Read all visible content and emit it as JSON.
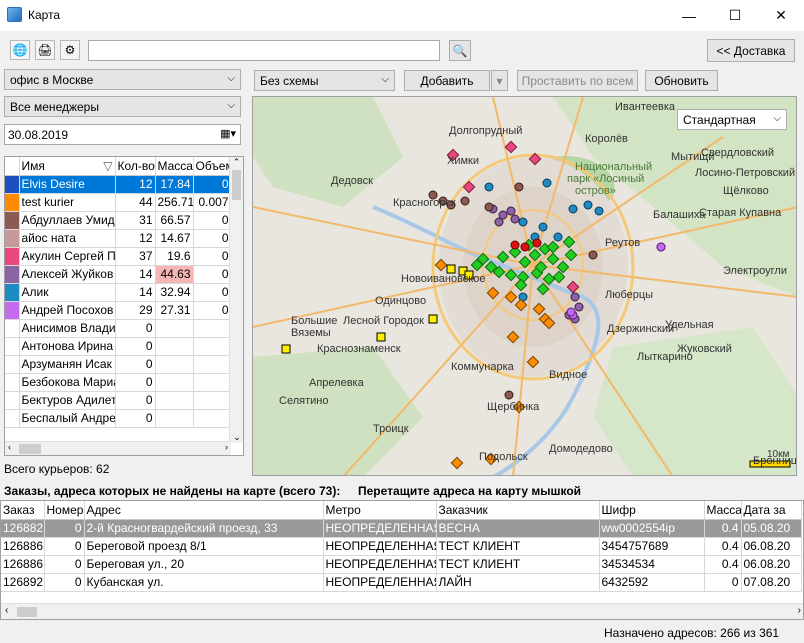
{
  "window": {
    "title": "Карта",
    "min": "—",
    "max": "☐",
    "close": "✕"
  },
  "toolbar": {
    "search_value": "",
    "delivery_button": "<< Доставка"
  },
  "filters": {
    "office": "офис в Москве",
    "managers": "Все менеджеры",
    "date": "30.08.2019"
  },
  "couriers": {
    "columns": [
      "Имя",
      "Кол-во",
      "Масса",
      "Объем"
    ],
    "rows": [
      {
        "color": "#1f4fbf",
        "name": "Elvis Desire",
        "qty": "12",
        "mass": "17.84",
        "vol": "0"
      },
      {
        "color": "#ff8c00",
        "name": "test kurier",
        "qty": "44",
        "mass": "256.71",
        "vol": "0.007"
      },
      {
        "color": "#8b5a52",
        "name": "Абдуллаев Умид Ш",
        "qty": "31",
        "mass": "66.57",
        "vol": "0"
      },
      {
        "color": "#c7999a",
        "name": "айос ната",
        "qty": "12",
        "mass": "14.67",
        "vol": "0"
      },
      {
        "color": "#e8487f",
        "name": "Акулин Сергей Пет",
        "qty": "37",
        "mass": "19.6",
        "vol": "0"
      },
      {
        "color": "#8b64a4",
        "name": "Алексей Жуйков",
        "qty": "14",
        "mass": "44.63",
        "vol": "0"
      },
      {
        "color": "#1e8bc3",
        "name": "Алик",
        "qty": "14",
        "mass": "32.94",
        "vol": "0"
      },
      {
        "color": "#c46cf0",
        "name": "Андрей Посохов",
        "qty": "29",
        "mass": "27.31",
        "vol": "0"
      },
      {
        "color": "",
        "name": "Анисимов Владисла",
        "qty": "0",
        "mass": "",
        "vol": ""
      },
      {
        "color": "",
        "name": "Антонова Ирина В",
        "qty": "0",
        "mass": "",
        "vol": ""
      },
      {
        "color": "",
        "name": "Арзуманян Исак В",
        "qty": "0",
        "mass": "",
        "vol": ""
      },
      {
        "color": "",
        "name": "Безбокова Мариан",
        "qty": "0",
        "mass": "",
        "vol": ""
      },
      {
        "color": "",
        "name": "Бектуров Адилет Т",
        "qty": "0",
        "mass": "",
        "vol": ""
      },
      {
        "color": "",
        "name": "Беспалый Андрей",
        "qty": "0",
        "mass": "",
        "vol": ""
      }
    ],
    "total": "Всего курьеров: 62"
  },
  "map_toolbar": {
    "scheme": "Без схемы",
    "add": "Добавить",
    "assign_all": "Проставить по всем",
    "refresh": "Обновить",
    "map_type": "Стандартная"
  },
  "map_labels": [
    "Ивантеевка",
    "Долгопрудный",
    "Королёв",
    "Мытищи",
    "Химки",
    "Национальный",
    "парк «Лосиный",
    "остров»",
    "Свердловский",
    "Дедовск",
    "Лосино-Петровский",
    "Красногорск",
    "Балашиха",
    "Старая Купавна",
    "Щёлково",
    "Реутов",
    "Электроугли",
    "Новоивановское",
    "Одинцово",
    "Люберцы",
    "Большие",
    "Вяземы",
    "Лесной Городок",
    "Дзержинский",
    "Удельная",
    "Краснознаменск",
    "Жуковский",
    "Лыткарино",
    "Коммунарка",
    "Видное",
    "Апрелевка",
    "Селятино",
    "Щербинка",
    "Троицк",
    "Домодедово",
    "Подольск",
    "Бронницы",
    "10км"
  ],
  "missing": {
    "header": "Заказы, адреса которых не найдены на карте (всего 73):",
    "hint": "Перетащите адреса на карту мышкой"
  },
  "orders": {
    "columns": [
      "Заказ",
      "Номер",
      "Адрес",
      "Метро",
      "Заказчик",
      "Шифр",
      "Масса",
      "Дата за"
    ],
    "rows": [
      {
        "order": "126882",
        "num": "0",
        "address": "2-й Красногвардейский проезд, 33",
        "metro": "НЕОПРЕДЕЛЕННАЯ",
        "customer": "ВЕСНА",
        "code": "ww0002554ip",
        "mass": "0.4",
        "date": "05.08.20"
      },
      {
        "order": "126886",
        "num": "0",
        "address": "Береговой проезд 8/1",
        "metro": "НЕОПРЕДЕЛЕННАЯ",
        "customer": "ТЕСТ КЛИЕНТ",
        "code": "3454757689",
        "mass": "0.4",
        "date": "06.08.20"
      },
      {
        "order": "126886",
        "num": "0",
        "address": "Береговая ул., 20",
        "metro": "НЕОПРЕДЕЛЕННАЯ",
        "customer": "ТЕСТ КЛИЕНТ",
        "code": "34534534",
        "mass": "0.4",
        "date": "06.08.20"
      },
      {
        "order": "126892",
        "num": "0",
        "address": "Кубанская ул.",
        "metro": "НЕОПРЕДЕЛЕННАЯ",
        "customer": "ЛАЙН",
        "code": "6432592",
        "mass": "0",
        "date": "07.08.20"
      }
    ]
  },
  "status": {
    "assigned": "Назначено адресов: 266 из 361"
  }
}
